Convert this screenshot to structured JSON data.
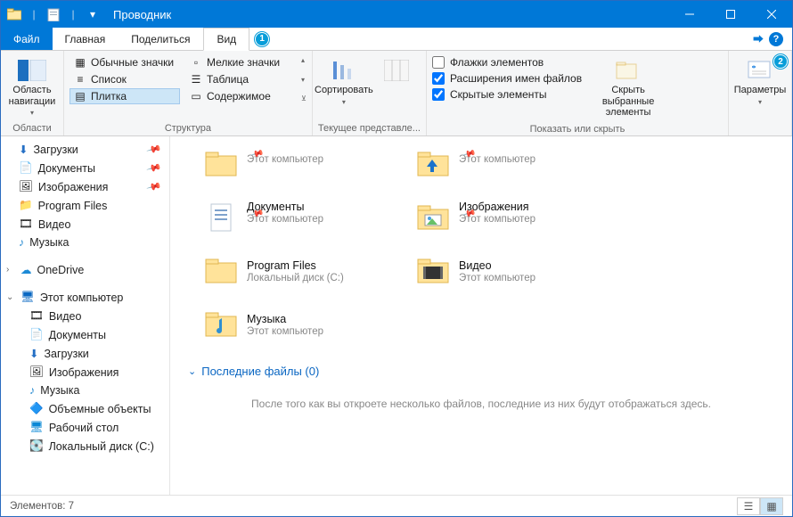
{
  "window": {
    "title": "Проводник"
  },
  "tabs": {
    "file": "Файл",
    "home": "Главная",
    "share": "Поделиться",
    "view": "Вид"
  },
  "ribbon": {
    "panes": {
      "label": "Область навигации",
      "group": "Области"
    },
    "layout": {
      "regular_icons": "Обычные значки",
      "small_icons": "Мелкие значки",
      "list": "Список",
      "table": "Таблица",
      "tiles": "Плитка",
      "content": "Содержимое",
      "group": "Структура"
    },
    "current": {
      "sort": "Сортировать",
      "group": "Текущее представле..."
    },
    "showhide": {
      "cb1": "Флажки элементов",
      "cb2": "Расширения имен файлов",
      "cb3": "Скрытые элементы",
      "hidebtn": "Скрыть выбранные элементы",
      "group": "Показать или скрыть"
    },
    "options": {
      "label": "Параметры"
    }
  },
  "sidebar": {
    "downloads": "Загрузки",
    "documents": "Документы",
    "pictures": "Изображения",
    "program_files": "Program Files",
    "videos": "Видео",
    "music": "Музыка",
    "onedrive": "OneDrive",
    "this_pc": "Этот компьютер",
    "pc_videos": "Видео",
    "pc_documents": "Документы",
    "pc_downloads": "Загрузки",
    "pc_pictures": "Изображения",
    "pc_music": "Музыка",
    "pc_3d": "Объемные объекты",
    "pc_desktop": "Рабочий стол",
    "pc_disk_c": "Локальный диск (C:)"
  },
  "tiles": {
    "sub_this_pc": "Этот компьютер",
    "sub_local_c": "Локальный диск (C:)",
    "i1": "",
    "i2": "",
    "i3": "Документы",
    "i4": "Изображения",
    "i5": "Program Files",
    "i6": "Видео",
    "i7": "Музыка"
  },
  "recent": {
    "header": "Последние файлы (0)",
    "msg": "После того как вы откроете несколько файлов, последние из них будут отображаться здесь."
  },
  "status": {
    "count": "Элементов: 7"
  },
  "callouts": {
    "one": "1",
    "two": "2"
  }
}
